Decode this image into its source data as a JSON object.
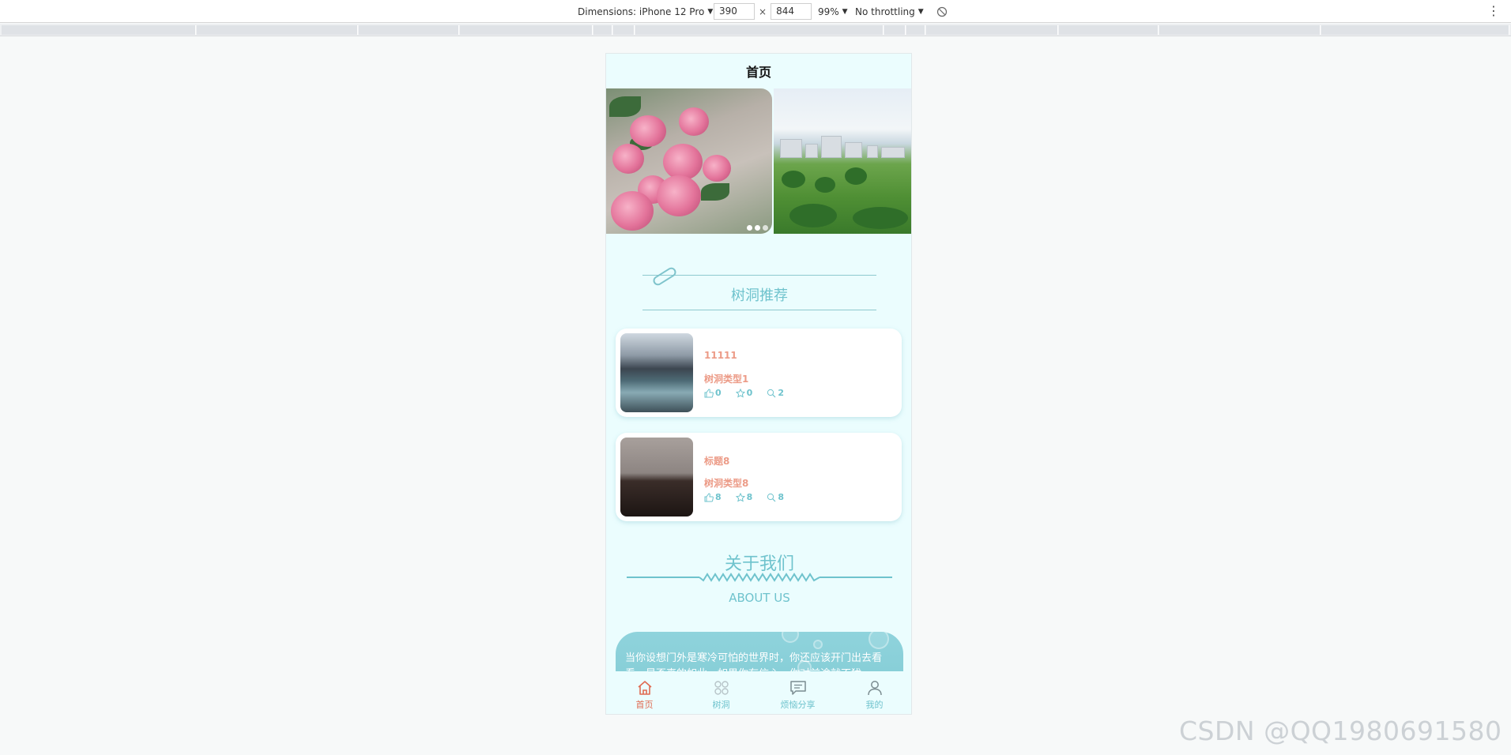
{
  "devtools": {
    "dimensions_label": "Dimensions: iPhone 12 Pro",
    "width": "390",
    "height": "844",
    "times": "×",
    "zoom": "99%",
    "throttling": "No throttling"
  },
  "page": {
    "title": "首页"
  },
  "swiper": {
    "dots": 3,
    "active_dot": 1
  },
  "recommend": {
    "section_title": "树洞推荐",
    "items": [
      {
        "title": "11111",
        "type": "树洞类型1",
        "likes": "0",
        "favorites": "0",
        "views": "2"
      },
      {
        "title": "标题8",
        "type": "树洞类型8",
        "likes": "8",
        "favorites": "8",
        "views": "8"
      }
    ]
  },
  "about": {
    "title": "关于我们",
    "subtitle": "ABOUT US",
    "text": "当你设想门外是寒冷可怕的世界时，你还应该开门出去看看，是否真的如此。如果你有信心，你对前途就不犹"
  },
  "tabbar": {
    "items": [
      {
        "label": "首页",
        "icon": "home-icon",
        "active": true
      },
      {
        "label": "树洞",
        "icon": "grid-icon",
        "active": false
      },
      {
        "label": "烦恼分享",
        "icon": "chat-icon",
        "active": false
      },
      {
        "label": "我的",
        "icon": "user-icon",
        "active": false
      }
    ]
  },
  "colors": {
    "accent": "#6fc3cd",
    "highlight": "#ec9b87",
    "active_tab": "#e06b52",
    "page_bg": "#ebfdfe"
  },
  "watermark": "CSDN @QQ1980691580"
}
